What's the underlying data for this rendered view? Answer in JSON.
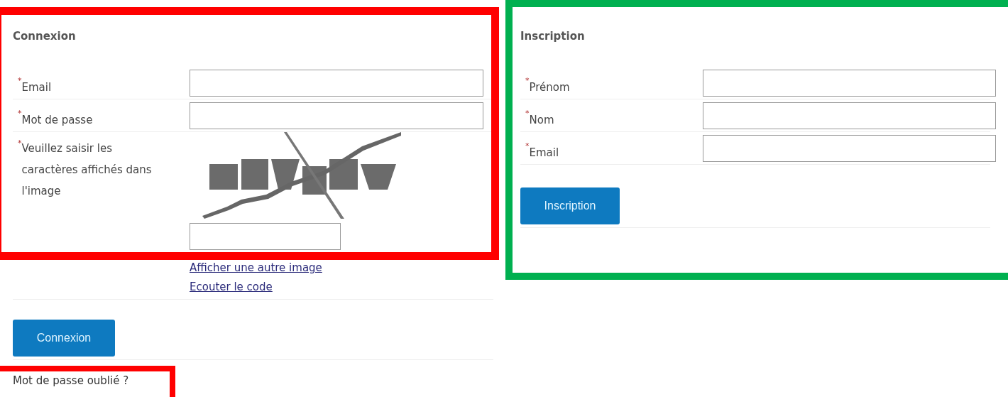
{
  "login": {
    "title": "Connexion",
    "fields": [
      {
        "marker": "*",
        "label": "Email"
      },
      {
        "marker": "*",
        "label": "Mot de passe"
      }
    ],
    "captcha": {
      "marker": "*",
      "label": "Veuillez saisir les caractères affichés dans l'image",
      "kind": "picture"
    },
    "links": [
      "Afficher une autre image",
      "Ecouter le code"
    ],
    "button": "Connexion",
    "forgot_link": "Mot de passe oublié ?"
  },
  "signup": {
    "title": "Inscription",
    "fields": [
      {
        "marker": "*",
        "label": "Prénom"
      },
      {
        "marker": "*",
        "label": "Nom"
      },
      {
        "marker": "*",
        "label": "Email"
      }
    ],
    "button": "Inscription"
  },
  "highlight_frames": [
    {
      "color": "#ff0000"
    },
    {
      "color": "#00b050"
    },
    {
      "color": "#ff0000"
    }
  ]
}
